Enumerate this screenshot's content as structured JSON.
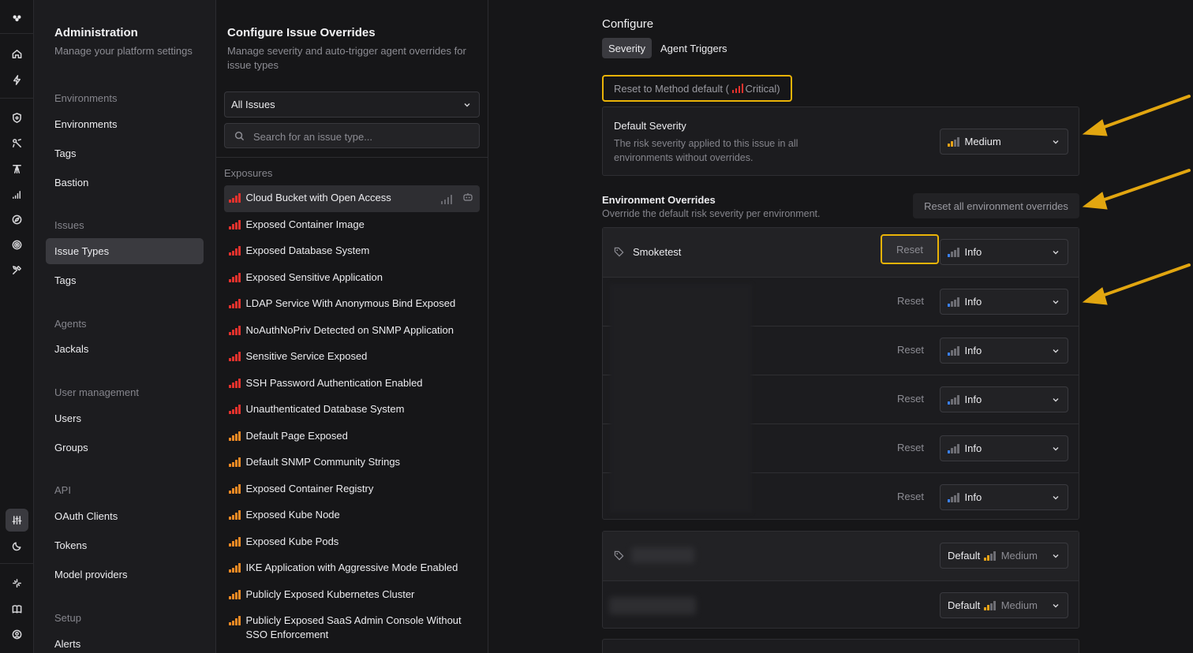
{
  "rail": {
    "icons": [
      "logo-icon",
      "home-icon",
      "bolt-icon",
      "shield-icon",
      "scan-icon",
      "tower-icon",
      "signal-icon",
      "compass-icon",
      "target-icon",
      "tools-icon",
      "sliders-icon",
      "moon-icon",
      "sparkle-icon",
      "book-icon",
      "user-icon"
    ]
  },
  "admin": {
    "title": "Administration",
    "subtitle": "Manage your platform settings",
    "sections": [
      {
        "label": "Environments",
        "items": [
          "Environments",
          "Tags",
          "Bastion"
        ]
      },
      {
        "label": "Issues",
        "items": [
          "Issue Types",
          "Tags"
        ]
      },
      {
        "label": "Agents",
        "items": [
          "Jackals"
        ]
      },
      {
        "label": "User management",
        "items": [
          "Users",
          "Groups"
        ]
      },
      {
        "label": "API",
        "items": [
          "OAuth Clients",
          "Tokens",
          "Model providers"
        ]
      },
      {
        "label": "Setup",
        "items": [
          "Alerts"
        ]
      }
    ],
    "active_item": "Issue Types"
  },
  "issues": {
    "title": "Configure Issue Overrides",
    "description": "Manage severity and auto-trigger agent overrides for issue types",
    "filter_value": "All Issues",
    "search_placeholder": "Search for an issue type...",
    "group_label": "Exposures",
    "items": [
      {
        "label": "Cloud Bucket with Open Access",
        "severity": "critical"
      },
      {
        "label": "Exposed Container Image",
        "severity": "critical"
      },
      {
        "label": "Exposed Database System",
        "severity": "critical"
      },
      {
        "label": "Exposed Sensitive Application",
        "severity": "critical"
      },
      {
        "label": "LDAP Service With Anonymous Bind Exposed",
        "severity": "critical"
      },
      {
        "label": "NoAuthNoPriv Detected on SNMP Application",
        "severity": "critical"
      },
      {
        "label": "Sensitive Service Exposed",
        "severity": "critical"
      },
      {
        "label": "SSH Password Authentication Enabled",
        "severity": "critical"
      },
      {
        "label": "Unauthenticated Database System",
        "severity": "critical"
      },
      {
        "label": "Default Page Exposed",
        "severity": "high"
      },
      {
        "label": "Default SNMP Community Strings",
        "severity": "high"
      },
      {
        "label": "Exposed Container Registry",
        "severity": "high"
      },
      {
        "label": "Exposed Kube Node",
        "severity": "high"
      },
      {
        "label": "Exposed Kube Pods",
        "severity": "high"
      },
      {
        "label": "IKE Application with Aggressive Mode Enabled",
        "severity": "high"
      },
      {
        "label": "Publicly Exposed Kubernetes Cluster",
        "severity": "high"
      },
      {
        "label": "Publicly Exposed SaaS Admin Console Without SSO Enforcement",
        "severity": "high"
      }
    ]
  },
  "main": {
    "configure_label": "Configure",
    "tabs": [
      "Severity",
      "Agent Triggers"
    ],
    "active_tab": "Severity",
    "method_reset": {
      "prefix": "Reset to Method default (",
      "severity": "Critical",
      "suffix": ")"
    },
    "default_severity": {
      "title": "Default Severity",
      "description": "The risk severity applied to this issue in all environments without overrides.",
      "value": "Medium"
    },
    "env_overrides": {
      "title": "Environment Overrides",
      "description": "Override the default risk severity per environment.",
      "reset_all_label": "Reset all environment overrides"
    },
    "env_rows": [
      {
        "name": "Smoketest",
        "reset": "Reset",
        "value": "Info"
      },
      {
        "name": "",
        "reset": "Reset",
        "value": "Info"
      },
      {
        "name": "",
        "reset": "Reset",
        "value": "Info"
      },
      {
        "name": "",
        "reset": "Reset",
        "value": "Info"
      },
      {
        "name": "",
        "reset": "Reset",
        "value": "Info"
      },
      {
        "name": "",
        "reset": "Reset",
        "value": "Info"
      }
    ],
    "group_rows": [
      {
        "default_label": "Default",
        "value": "Medium"
      },
      {
        "default_label": "Default",
        "value": "Medium"
      }
    ]
  },
  "colors": {
    "critical": "#e5322d",
    "high": "#f08a24",
    "medium": "#e8a317",
    "info": "#3b82f6",
    "highlight": "#eab308",
    "arrow": "#e2a610"
  }
}
